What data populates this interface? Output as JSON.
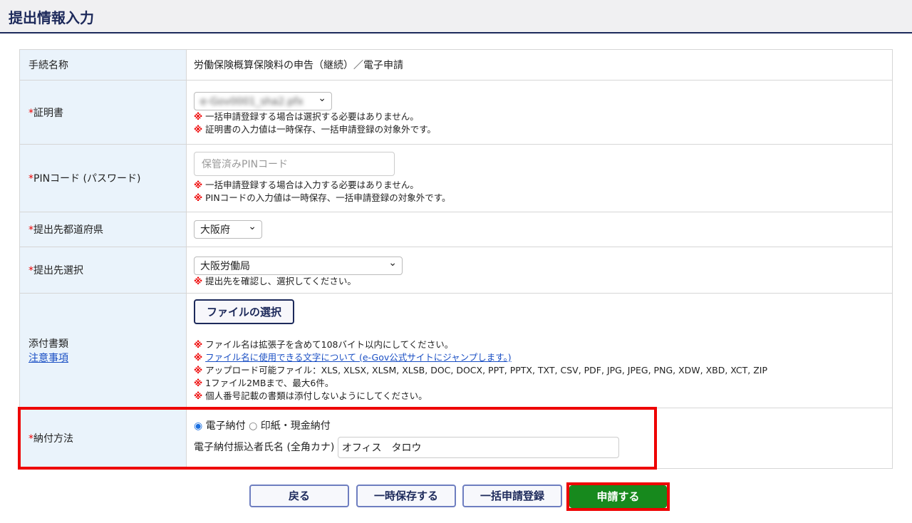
{
  "page_title": "提出情報入力",
  "rows": {
    "procedure": {
      "label": "手続名称",
      "value": "労働保険概算保険料の申告（継続）／電子申請"
    },
    "certificate": {
      "required": "*",
      "label": "証明書",
      "selected": "e-Gov0001_sha2.pfx",
      "notes": [
        "一括申請登録する場合は選択する必要はありません。",
        "証明書の入力値は一時保存、一括申請登録の対象外です。"
      ]
    },
    "pin": {
      "required": "*",
      "label": "PINコード (パスワード)",
      "placeholder": "保管済みPINコード",
      "notes": [
        "一括申請登録する場合は入力する必要はありません。",
        "PINコードの入力値は一時保存、一括申請登録の対象外です。"
      ]
    },
    "prefecture": {
      "required": "*",
      "label": "提出先都道府県",
      "selected": "大阪府"
    },
    "destination": {
      "required": "*",
      "label": "提出先選択",
      "selected": "大阪労働局",
      "notes": [
        "提出先を確認し、選択してください。"
      ]
    },
    "attachment": {
      "label": "添付書類",
      "link": "注意事項",
      "button": "ファイルの選択",
      "notes": [
        "ファイル名は拡張子を含めて108バイト以内にしてください。",
        "ファイル名に使用できる文字について (e-Gov公式サイトにジャンプします。)",
        "アップロード可能ファイル：XLS, XLSX, XLSM, XLSB, DOC, DOCX, PPT, PPTX, TXT, CSV, PDF, JPG, JPEG, PNG, XDW, XBD, XCT, ZIP",
        "1ファイル2MBまで、最大6件。",
        "個人番号記載の書類は添付しないようにしてください。"
      ]
    },
    "payment": {
      "required": "*",
      "label": "納付方法",
      "options": [
        "電子納付",
        "印紙・現金納付"
      ],
      "selected": "電子納付",
      "payer_label": "電子納付振込者氏名 (全角カナ)",
      "payer_value": "オフィス　タロウ"
    }
  },
  "note_mark": "※",
  "buttons": {
    "back": "戻る",
    "save": "一時保存する",
    "bulk": "一括申請登録",
    "submit": "申請する"
  }
}
